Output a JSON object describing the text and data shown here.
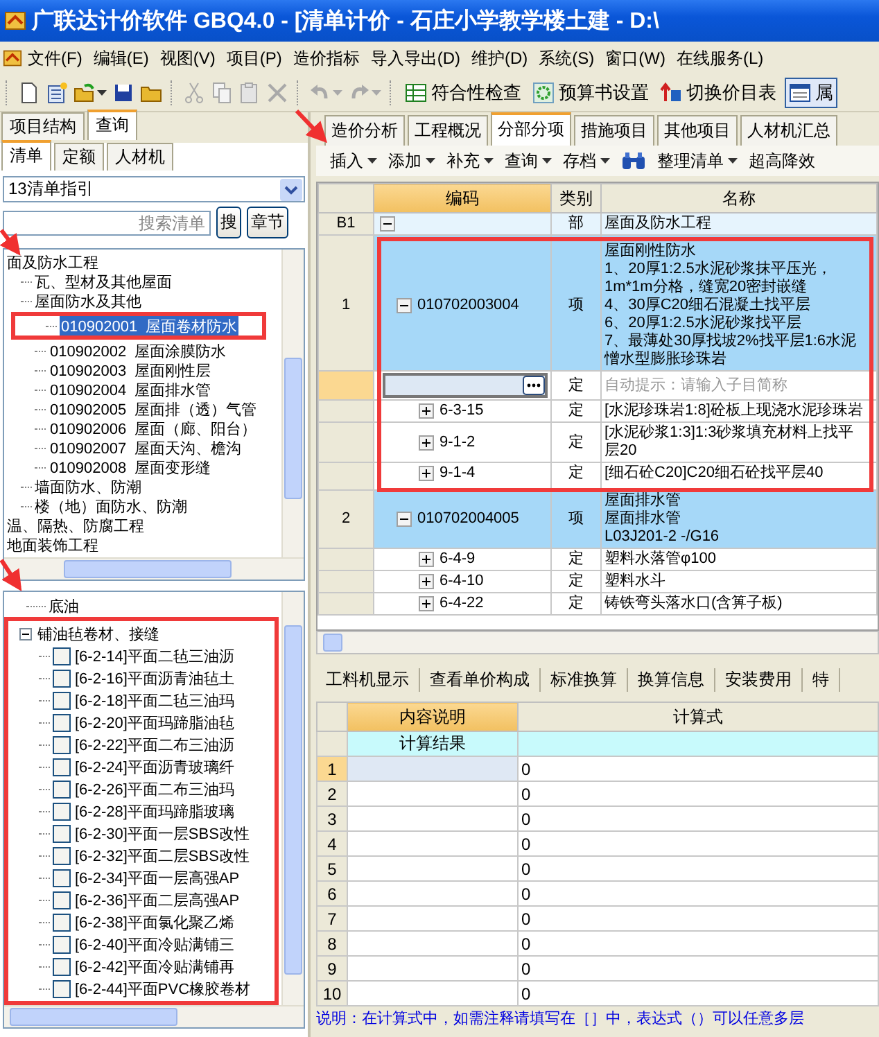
{
  "window": {
    "title": "广联达计价软件 GBQ4.0 - [清单计价 - 石庄小学教学楼土建 - D:\\"
  },
  "menu": [
    "文件(F)",
    "编辑(E)",
    "视图(V)",
    "项目(P)",
    "造价指标",
    "导入导出(D)",
    "维护(D)",
    "系统(S)",
    "窗口(W)",
    "在线服务(L)"
  ],
  "toolbar": {
    "icon_groups": [
      [
        {
          "kind": "new-file",
          "disabled": false,
          "dropdown": false
        },
        {
          "kind": "new-project",
          "disabled": false,
          "dropdown": false
        },
        {
          "kind": "open",
          "disabled": false,
          "dropdown": true
        },
        {
          "kind": "save",
          "disabled": false,
          "dropdown": false
        },
        {
          "kind": "folder",
          "disabled": false,
          "dropdown": false
        }
      ],
      [
        {
          "kind": "cut",
          "disabled": true,
          "dropdown": false
        },
        {
          "kind": "copy",
          "disabled": true,
          "dropdown": false
        },
        {
          "kind": "paste",
          "disabled": true,
          "dropdown": false
        },
        {
          "kind": "delete",
          "disabled": true,
          "dropdown": false
        }
      ],
      [
        {
          "kind": "undo",
          "disabled": true,
          "dropdown": true
        },
        {
          "kind": "redo",
          "disabled": true,
          "dropdown": true
        }
      ]
    ],
    "buttons": [
      {
        "kind": "table",
        "label": "符合性检查"
      },
      {
        "kind": "gear",
        "label": "预算书设置"
      },
      {
        "kind": "switch",
        "label": "切换价目表"
      },
      {
        "kind": "window",
        "label": "属"
      }
    ]
  },
  "left_panel": {
    "tabs": [
      {
        "label": "项目结构",
        "selected": false
      },
      {
        "label": "查询",
        "selected": true
      }
    ],
    "subtabs": [
      {
        "label": "清单",
        "selected": true
      },
      {
        "label": "定额",
        "selected": false
      },
      {
        "label": "人材机",
        "selected": false
      }
    ],
    "dropdown": {
      "value": "13清单指引"
    },
    "search": {
      "placeholder": "搜索清单"
    },
    "search_buttons": [
      "搜",
      "章节"
    ],
    "tree": [
      {
        "label": "面及防水工程",
        "children": [
          {
            "label": "瓦、型材及其他屋面"
          },
          {
            "label": "屋面防水及其他",
            "children": [
              {
                "code": "010902001",
                "name": "屋面卷材防水",
                "selected": true,
                "annotated": true
              },
              {
                "code": "010902002",
                "name": "屋面涂膜防水",
                "selected": false
              },
              {
                "code": "010902003",
                "name": "屋面刚性层",
                "selected": false
              },
              {
                "code": "010902004",
                "name": "屋面排水管",
                "selected": false
              },
              {
                "code": "010902005",
                "name": "屋面排（透）气管",
                "selected": false
              },
              {
                "code": "010902006",
                "name": "屋面（廊、阳台）",
                "selected": false
              },
              {
                "code": "010902007",
                "name": "屋面天沟、檐沟",
                "selected": false
              },
              {
                "code": "010902008",
                "name": "屋面变形缝",
                "selected": false
              }
            ]
          },
          {
            "label": "墙面防水、防潮"
          },
          {
            "label": "楼（地）面防水、防潮"
          }
        ]
      },
      {
        "label": "温、隔热、防腐工程"
      },
      {
        "label": "地面装饰工程"
      }
    ],
    "lower_tree": [
      {
        "kind": "leaf",
        "label": "底油"
      },
      {
        "kind": "group",
        "label": "铺油毡卷材、接缝",
        "expanded": true,
        "annotated": true,
        "children": [
          {
            "label": "[6-2-14]平面二毡三油沥",
            "checked": false
          },
          {
            "label": "[6-2-16]平面沥青油毡土",
            "checked": false
          },
          {
            "label": "[6-2-18]平面二毡三油玛",
            "checked": false
          },
          {
            "label": "[6-2-20]平面玛蹄脂油毡",
            "checked": false
          },
          {
            "label": "[6-2-22]平面二布三油沥",
            "checked": false
          },
          {
            "label": "[6-2-24]平面沥青玻璃纤",
            "checked": false
          },
          {
            "label": "[6-2-26]平面二布三油玛",
            "checked": false
          },
          {
            "label": "[6-2-28]平面玛蹄脂玻璃",
            "checked": false
          },
          {
            "label": "[6-2-30]平面一层SBS改性",
            "checked": false
          },
          {
            "label": "[6-2-32]平面二层SBS改性",
            "checked": false
          },
          {
            "label": "[6-2-34]平面一层高强AP",
            "checked": false
          },
          {
            "label": "[6-2-36]平面二层高强AP",
            "checked": false
          },
          {
            "label": "[6-2-38]平面氯化聚乙烯",
            "checked": false
          },
          {
            "label": "[6-2-40]平面冷贴满铺三",
            "checked": false
          },
          {
            "label": "[6-2-42]平面冷贴满铺再",
            "checked": false
          },
          {
            "label": "[6-2-44]平面PVC橡胶卷材",
            "checked": false
          }
        ]
      }
    ]
  },
  "right_panel": {
    "tabs": [
      {
        "label": "造价分析",
        "selected": false
      },
      {
        "label": "工程概况",
        "selected": false
      },
      {
        "label": "分部分项",
        "selected": true
      },
      {
        "label": "措施项目",
        "selected": false
      },
      {
        "label": "其他项目",
        "selected": false
      },
      {
        "label": "人材机汇总",
        "selected": false
      }
    ],
    "toolbar": [
      {
        "kind": "menu",
        "label": "插入",
        "dropdown": true
      },
      {
        "kind": "menu",
        "label": "添加",
        "dropdown": true
      },
      {
        "kind": "menu",
        "label": "补充",
        "dropdown": true
      },
      {
        "kind": "menu",
        "label": "查询",
        "dropdown": true
      },
      {
        "kind": "menu",
        "label": "存档",
        "dropdown": true
      },
      {
        "kind": "find"
      },
      {
        "kind": "menu",
        "label": "整理清单",
        "dropdown": true
      },
      {
        "kind": "menu",
        "label": "超高降效",
        "dropdown": false
      }
    ],
    "grid": {
      "columns": [
        "编码",
        "类别",
        "名称"
      ],
      "rows": [
        {
          "kind": "section",
          "num": "B1",
          "expanded": true,
          "type": "部",
          "name": "屋面及防水工程",
          "selected": false
        },
        {
          "kind": "item",
          "num": "1",
          "code": "010702003004",
          "expanded": true,
          "type": "项",
          "lines": [
            "屋面刚性防水",
            "1、20厚1:2.5水泥砂浆抹平压光，",
            "1m*1m分格，缝宽20密封嵌缝",
            "4、30厚C20细石混凝土找平层",
            "6、20厚1:2.5水泥砂浆找平层",
            "7、最薄处30厚找坡2%找平层1:6水泥憎水型膨胀珍珠岩"
          ],
          "selected": true,
          "annotated": true
        },
        {
          "kind": "input",
          "type": "定",
          "placeholder": "自动提示：请输入子目简称",
          "selected": false
        },
        {
          "kind": "sub",
          "code": "6-3-15",
          "expanded": false,
          "type": "定",
          "name": "[水泥珍珠岩1:8]砼板上现浇水泥珍珠岩",
          "selected": false
        },
        {
          "kind": "sub",
          "code": "9-1-2",
          "expanded": false,
          "type": "定",
          "name": "[水泥砂浆1:3]1:3砂浆填充材料上找平层20",
          "selected": false
        },
        {
          "kind": "sub",
          "code": "9-1-4",
          "expanded": false,
          "type": "定",
          "name": "[细石砼C20]C20细石砼找平层40",
          "selected": false
        },
        {
          "kind": "item",
          "num": "2",
          "code": "010702004005",
          "expanded": true,
          "type": "项",
          "lines": [
            "屋面排水管",
            "屋面排水管",
            "L03J201-2 -/G16"
          ],
          "selected": true,
          "annotated": false
        },
        {
          "kind": "sub",
          "code": "6-4-9",
          "expanded": false,
          "type": "定",
          "name": "塑料水落管φ100",
          "selected": false
        },
        {
          "kind": "sub",
          "code": "6-4-10",
          "expanded": false,
          "type": "定",
          "name": "塑料水斗",
          "selected": false
        },
        {
          "kind": "sub",
          "code": "6-4-22",
          "expanded": false,
          "type": "定",
          "name": "铸铁弯头落水口(含箅子板)",
          "selected": false
        }
      ]
    },
    "detail_tabs": [
      "工料机显示",
      "查看单价构成",
      "标准换算",
      "换算信息",
      "安装费用",
      "特"
    ],
    "detail_grid": {
      "columns": [
        "内容说明",
        "计算式"
      ],
      "result_label": "计算结果",
      "rows": [
        {
          "num": "1",
          "value": "0",
          "selected": true
        },
        {
          "num": "2",
          "value": "0",
          "selected": false
        },
        {
          "num": "3",
          "value": "0",
          "selected": false
        },
        {
          "num": "4",
          "value": "0",
          "selected": false
        },
        {
          "num": "5",
          "value": "0",
          "selected": false
        },
        {
          "num": "6",
          "value": "0",
          "selected": false
        },
        {
          "num": "7",
          "value": "0",
          "selected": false
        },
        {
          "num": "8",
          "value": "0",
          "selected": false
        },
        {
          "num": "9",
          "value": "0",
          "selected": false
        },
        {
          "num": "10",
          "value": "0",
          "selected": false
        }
      ]
    },
    "status": "说明：在计算式中，如需注释请填写在［］中，表达式（）可以任意多层"
  }
}
